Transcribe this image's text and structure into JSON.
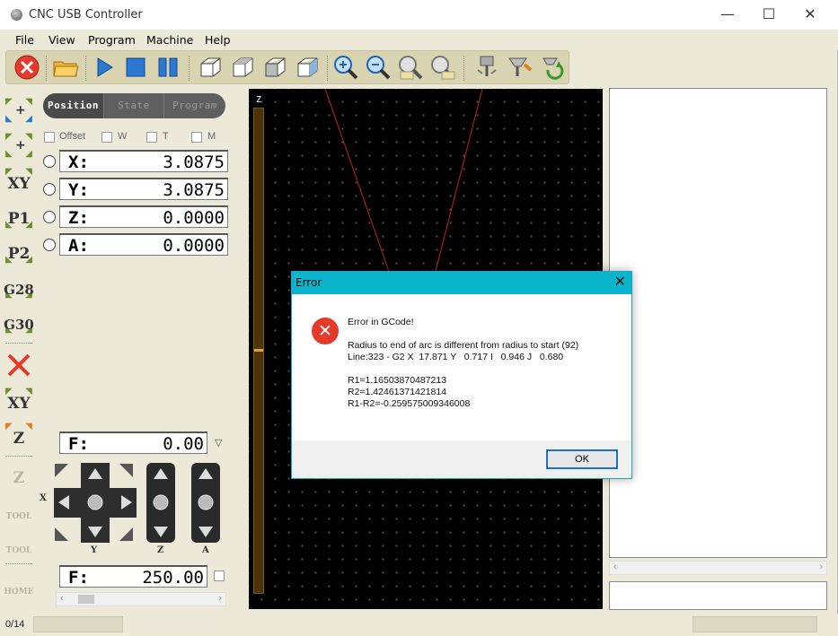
{
  "window": {
    "title": "CNC USB Controller",
    "minimize": "—",
    "maximize": "☐",
    "close": "✕"
  },
  "menu": [
    "File",
    "View",
    "Program",
    "Machine",
    "Help"
  ],
  "tabs": [
    "Position",
    "State",
    "Program"
  ],
  "checkboxes": [
    "Offset",
    "W",
    "T",
    "M"
  ],
  "dro": [
    {
      "axis": "X:",
      "value": "3.0875"
    },
    {
      "axis": "Y:",
      "value": "3.0875"
    },
    {
      "axis": "Z:",
      "value": "0.0000"
    },
    {
      "axis": "A:",
      "value": "0.0000"
    }
  ],
  "left_toolbar": [
    "XY",
    "P1",
    "P2",
    "G28",
    "G30",
    "XY",
    "Z",
    "Z",
    "TOOL",
    "TOOL",
    "HOME"
  ],
  "feed": {
    "label": "F:",
    "value": "0.00"
  },
  "feed2": {
    "label": "F:",
    "value": "250.00"
  },
  "jog_labels": {
    "x": "X",
    "y": "Y",
    "z": "Z",
    "a": "A"
  },
  "view": {
    "z_label": "Z"
  },
  "status": {
    "text": "0/14"
  },
  "dialog": {
    "title": "Error",
    "close": "✕",
    "icon": "error-icon",
    "heading": "Error in GCode!",
    "line1": "Radius to end of arc is different from radius to start (92)",
    "line2": "Line:323 - G2 X  17.871 Y   0.717 I   0.946 J   0.680",
    "r1": "R1=1.16503870487213",
    "r2": "R2=1.42461371421814",
    "diff": "R1-R2=-0.259575009346008",
    "ok": "OK"
  },
  "colors": {
    "dialog_title": "#09b4cc",
    "view_bg": "#000000",
    "toolpath": "#c0201a",
    "error_icon": "#e53a2a"
  }
}
